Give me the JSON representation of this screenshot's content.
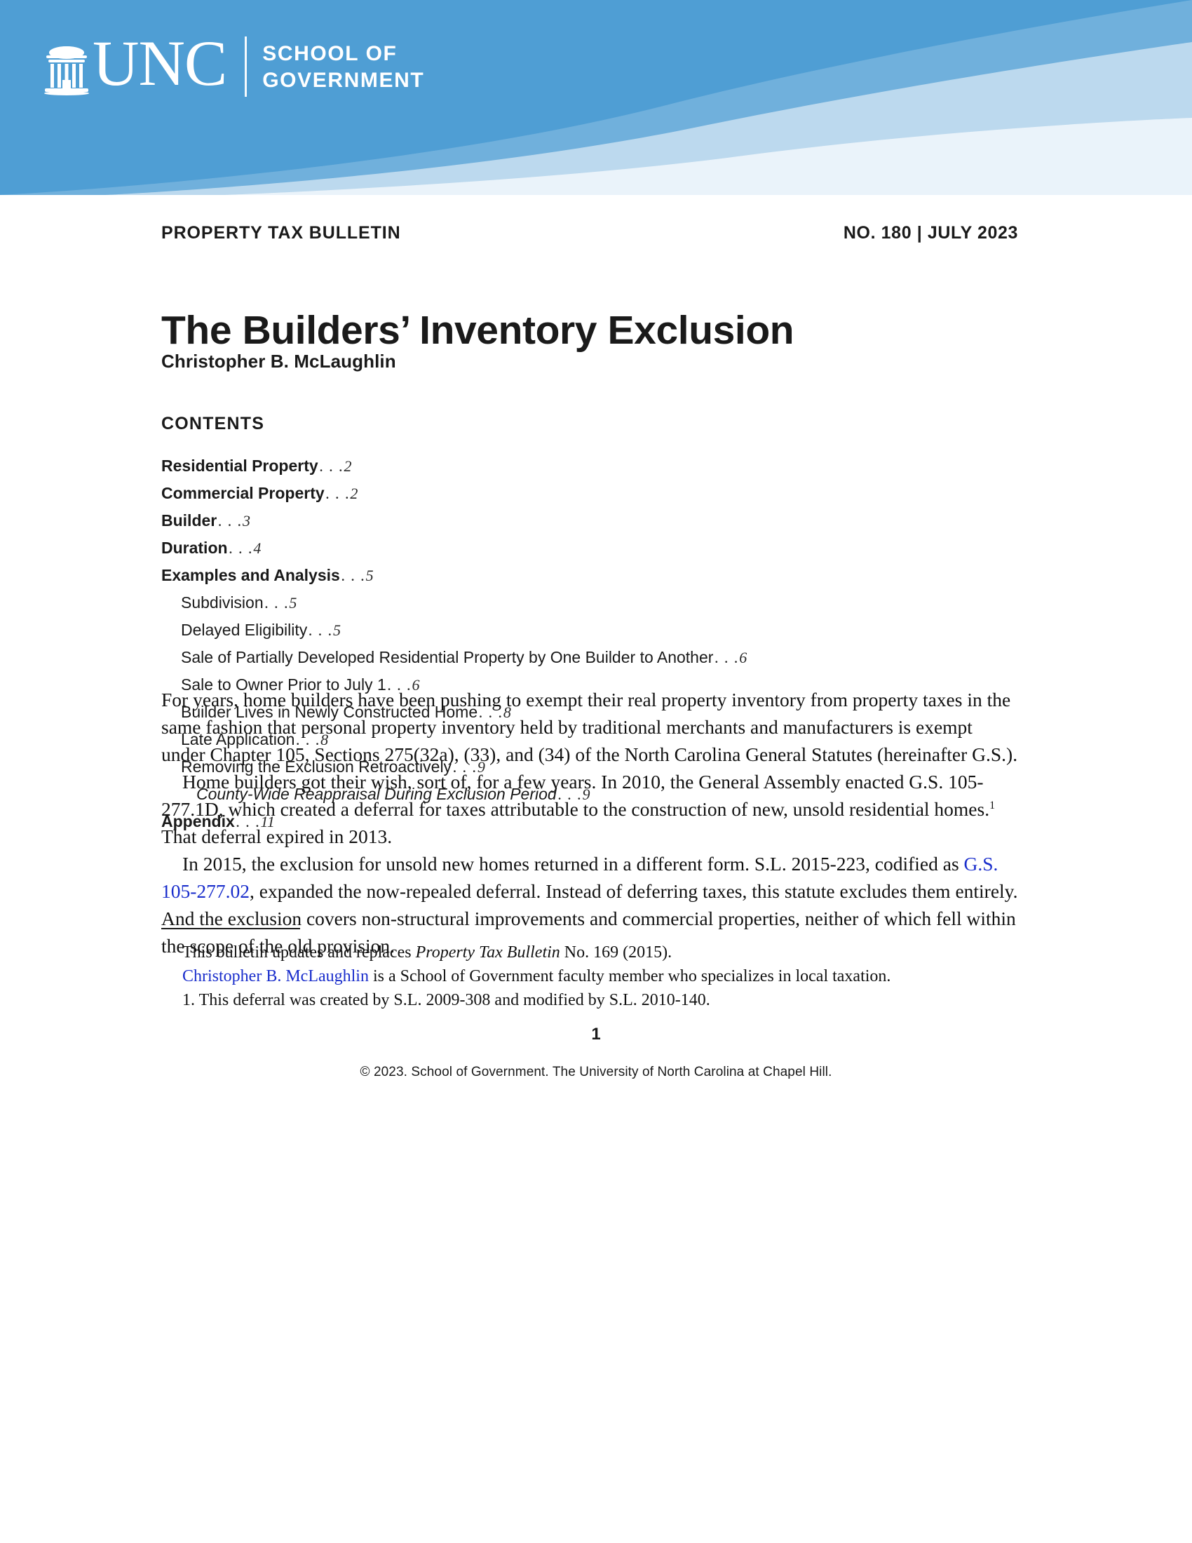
{
  "brand": {
    "banner_color": "#4f9ed4",
    "swoosh_color": "#a9cfe9",
    "swoosh_tip_color": "#e8f1f9",
    "unc_wordmark": "UNC",
    "school_line_1": "SCHOOL OF",
    "school_line_2": "GOVERNMENT",
    "old_well_icon": "old-well-icon"
  },
  "meta": {
    "series": "PROPERTY TAX BULLETIN",
    "issue": "NO. 180 | JULY 2023"
  },
  "title": "The Builders’ Inventory Exclusion",
  "author": "Christopher B. McLaughlin",
  "contents": {
    "heading": "CONTENTS",
    "items": [
      {
        "label": "Residential Property",
        "page": "2",
        "level": 1
      },
      {
        "label": "Commercial Property",
        "page": "2",
        "level": 1
      },
      {
        "label": "Builder",
        "page": "3",
        "level": 1
      },
      {
        "label": "Duration",
        "page": "4",
        "level": 1
      },
      {
        "label": "Examples and Analysis",
        "page": "5",
        "level": 1
      },
      {
        "label": "Subdivision",
        "page": "5",
        "level": 2
      },
      {
        "label": "Delayed Eligibility",
        "page": "5",
        "level": 2
      },
      {
        "label": "Sale of Partially Developed Residential Property by One Builder to Another",
        "page": "6",
        "level": 2
      },
      {
        "label": "Sale to Owner Prior to July 1",
        "page": "6",
        "level": 2
      },
      {
        "label": "Builder Lives in Newly Constructed Home",
        "page": "8",
        "level": 2
      },
      {
        "label": "Late Application",
        "page": "8",
        "level": 2
      },
      {
        "label": "Removing the Exclusion Retroactively",
        "page": "9",
        "level": 2
      },
      {
        "label": "County-Wide Reappraisal During Exclusion Period",
        "page": "9",
        "level": 3
      },
      {
        "label": "Appendix",
        "page": "11",
        "level": 1
      }
    ],
    "leader": ". . ."
  },
  "body": {
    "p1": "For years, home builders have been pushing to exempt their real property inventory from property taxes in the same fashion that personal property inventory held by traditional merchants and manufacturers is exempt under Chapter 105, Sections 275(32a), (33), and (34) of the North Carolina General Statutes (hereinafter G.S.).",
    "p2_a": "Home builders got their wish, sort of, for a few years. In 2010, the General Assembly enacted G.S. 105-277.1D, which created a deferral for taxes attributable to the construction of new, unsold residential homes.",
    "p2_footnote_marker": "1",
    "p2_b": " That deferral expired in 2013.",
    "p3_a": "In 2015, the exclusion for unsold new homes returned in a different form. S.L. 2015-223, codified as ",
    "p3_link": "G.S. 105-277.02",
    "p3_b": ", expanded the now-repealed deferral. Instead of deferring taxes, this statute excludes them entirely. And the exclusion covers non-structural improvements and commercial properties, neither of which fell within the scope of the old provision."
  },
  "footnotes": {
    "note_update_a": "This bulletin updates and replaces ",
    "note_update_italic": "Property Tax Bulletin",
    "note_update_b": " No. 169 (2015).",
    "note_author_link": "Christopher B. McLaughlin",
    "note_author_rest": " is a School of Government faculty member who specializes in local taxation.",
    "note_1": "1. This deferral was created by S.L. 2009-308 and modified by S.L. 2010-140."
  },
  "footer": {
    "page_number": "1",
    "copyright": "© 2023. School of Government. The University of North Carolina at Chapel Hill."
  },
  "colors": {
    "link": "#1a2ecc",
    "text": "#121212"
  }
}
